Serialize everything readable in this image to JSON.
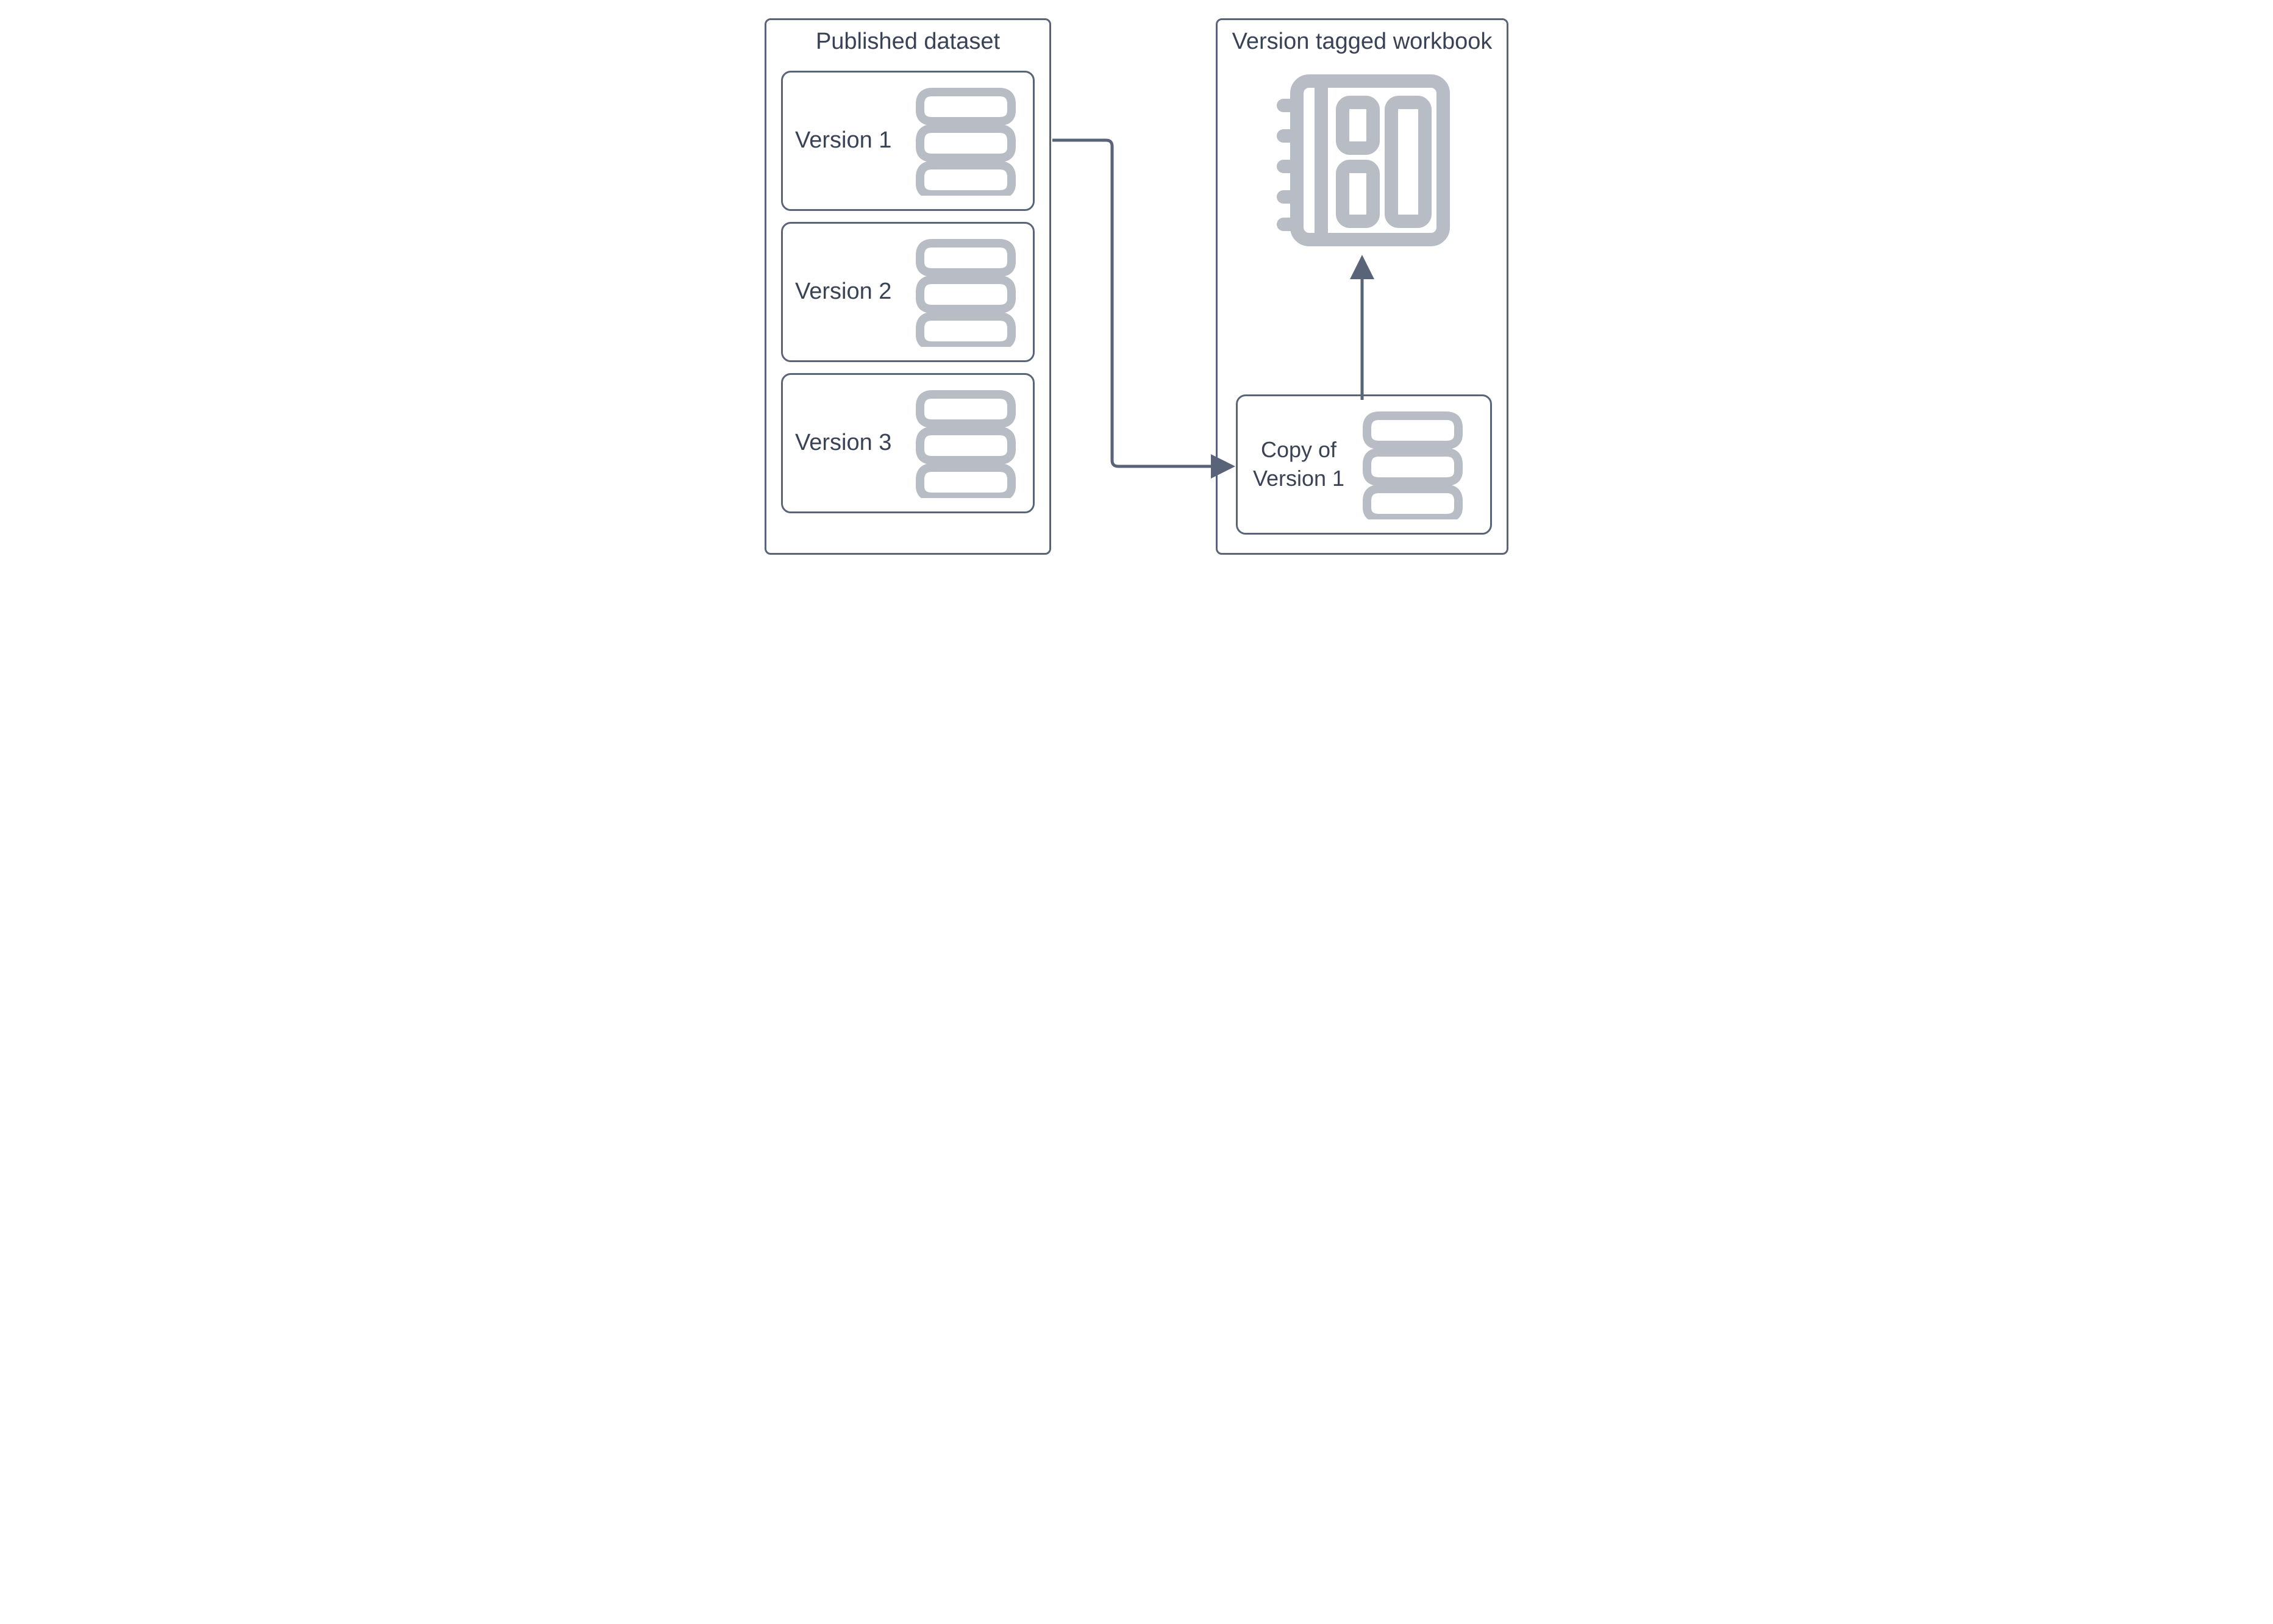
{
  "diagram": {
    "left_panel": {
      "title": "Published dataset",
      "versions": [
        {
          "label": "Version 1"
        },
        {
          "label": "Version 2"
        },
        {
          "label": "Version 3"
        }
      ]
    },
    "right_panel": {
      "title": "Version tagged workbook",
      "copy_card": {
        "label": "Copy of Version 1"
      }
    },
    "colors": {
      "border": "#5a6478",
      "text": "#3a4256",
      "icon": "#b8bcc4"
    }
  }
}
